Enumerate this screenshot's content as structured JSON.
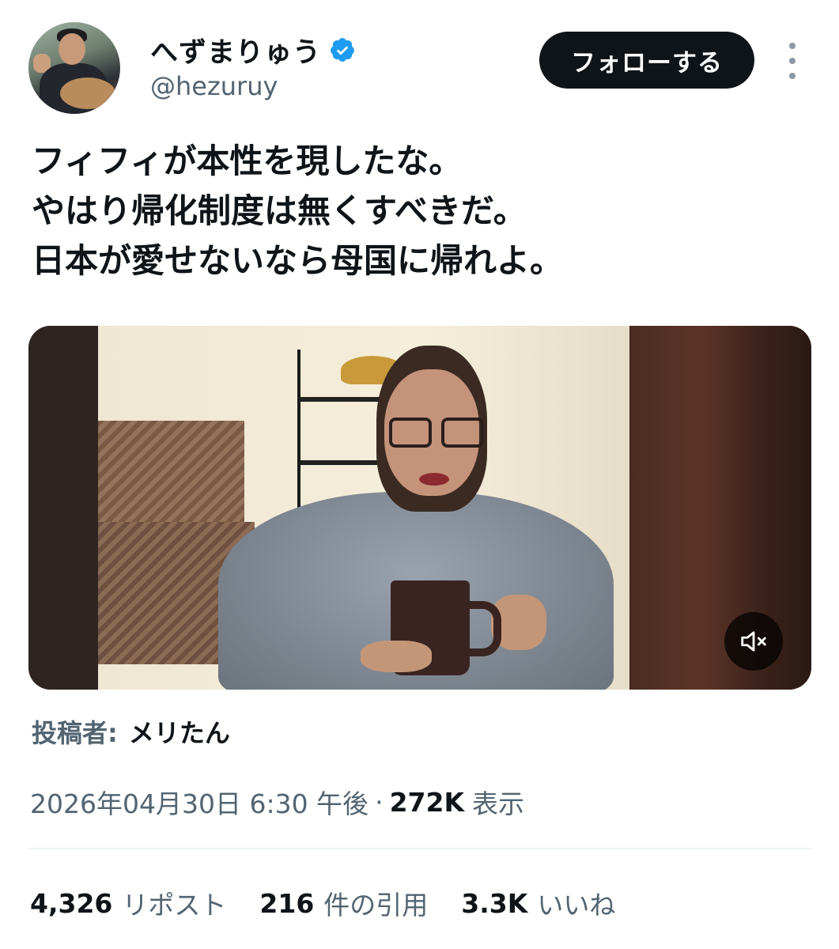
{
  "author": {
    "display_name": "へずまりゅう",
    "handle": "@hezuruy",
    "verified_icon": "verified-badge-icon",
    "verified_color": "#1d9bf0"
  },
  "actions": {
    "follow_label": "フォローする",
    "more_icon": "more-options-icon"
  },
  "tweet": {
    "lines": [
      "フィフィが本性を現したな。",
      "やはり帰化制度は無くすべきだ。",
      "日本が愛せないなら母国に帰れよ。"
    ]
  },
  "media": {
    "type": "video",
    "mute_icon": "volume-muted-icon"
  },
  "poster": {
    "label": "投稿者:",
    "name": "メリたん"
  },
  "meta": {
    "timestamp": "2026年04月30日 6:30 午後",
    "separator": "·",
    "views_count": "272K",
    "views_label": "表示"
  },
  "stats": {
    "reposts_count": "4,326",
    "reposts_label": "リポスト",
    "quotes_count": "216",
    "quotes_label": "件の引用",
    "likes_count": "3.3K",
    "likes_label": "いいね"
  },
  "colors": {
    "text_primary": "#0f1419",
    "text_secondary": "#536471",
    "follow_bg": "#0f1419",
    "divider": "#eff3f4"
  }
}
